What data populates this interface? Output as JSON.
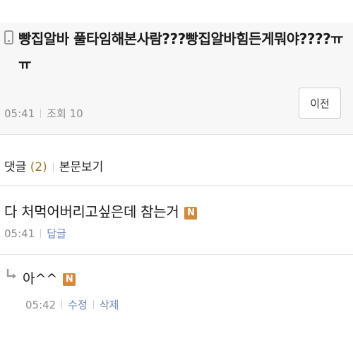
{
  "post": {
    "title": "빵집알바 풀타임해본사람???빵집알바힘든게뭐야????ㅠㅠ",
    "time": "05:41",
    "views": "조회 10",
    "prev_button": "이전"
  },
  "comments_bar": {
    "label": "댓글",
    "count": "(2)",
    "view_post": "본문보기"
  },
  "comment": {
    "text": "다 처먹어버리고싶은데 참는거",
    "badge": "N",
    "time": "05:41",
    "reply_link": "답글"
  },
  "reply": {
    "text": "아^^",
    "badge": "N",
    "time": "05:42",
    "edit_link": "수정",
    "delete_link": "삭제"
  },
  "colors": {
    "badge": "#d18a3c",
    "link": "#6e86b8",
    "meta": "#8c8c8c",
    "header_bg": "#f7f7f7"
  }
}
